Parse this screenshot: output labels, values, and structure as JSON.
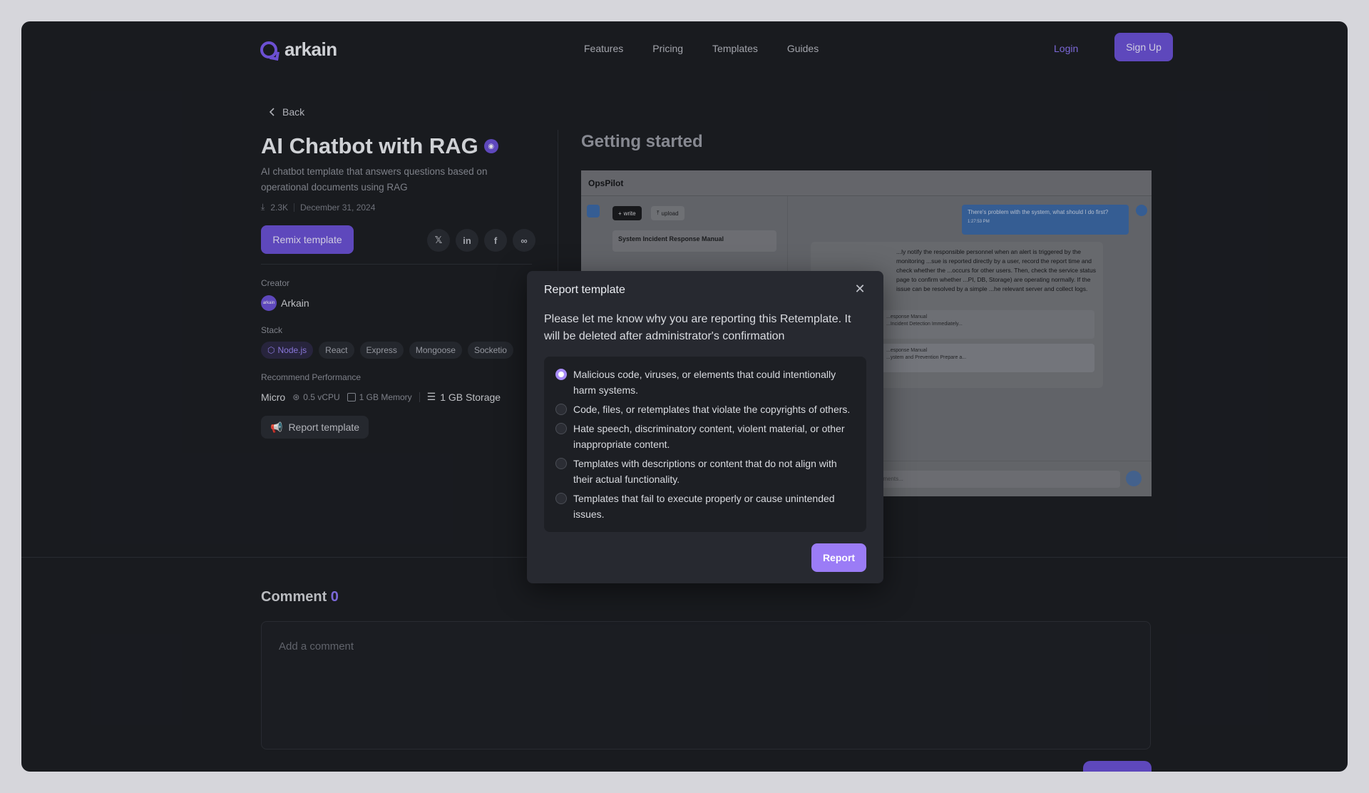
{
  "header": {
    "logo_text": "arkain",
    "nav": [
      "Features",
      "Pricing",
      "Templates",
      "Guides"
    ],
    "login": "Login",
    "signup": "Sign Up"
  },
  "template": {
    "back": "Back",
    "title": "AI Chatbot with RAG",
    "description": "AI chatbot template that answers questions based on operational documents using RAG",
    "downloads": "2.3K",
    "date": "December 31, 2024",
    "remix": "Remix template",
    "share_icons": [
      "x-icon",
      "linkedin-icon",
      "facebook-icon",
      "link-icon"
    ],
    "creator_label": "Creator",
    "creator_name": "Arkain",
    "creator_avatar_text": "arkain",
    "stack_label": "Stack",
    "stack": [
      "Node.js",
      "React",
      "Express",
      "Mongoose",
      "Socketio"
    ],
    "perf_label": "Recommend Performance",
    "perf": {
      "tier": "Micro",
      "cpu": "0.5 vCPU",
      "memory": "1 GB Memory",
      "storage": "1 GB Storage"
    },
    "report": "Report template"
  },
  "preview": {
    "section_title": "Getting started",
    "app_name": "OpsPilot",
    "write": "write",
    "upload": "upload",
    "doc_item": "System Incident Response Manual",
    "user_message": "There's problem with the system, what should I do first?",
    "message_time": "1:27:53 PM",
    "answer": "...ly notify the responsible personnel when an alert is triggered by the monitoring ...sue is reported directly by a user, record the report time and check whether the ...occurs for other users. Then, check the service status page to confirm whether ...PI, DB, Storage) are operating normally. If the issue can be resolved by a simple ...he relevant server and collect logs.",
    "source_1": "...esponse Manual",
    "source_1_sub": "...Incident Detection Immediately...",
    "source_2": "...esponse Manual",
    "source_2_sub": "...ystem and Prevention Prepare a...",
    "input_placeholder": "...ur documents..."
  },
  "comments": {
    "title": "Comment",
    "count": "0",
    "placeholder": "Add a comment"
  },
  "modal": {
    "title": "Report template",
    "intro": "Please let me know why you are reporting this Retemplate. It will be deleted after administrator's confirmation",
    "reasons": [
      {
        "text": "Malicious code, viruses, or elements that could intentionally harm systems.",
        "selected": true
      },
      {
        "text": "Code, files, or retemplates that violate the copyrights of others.",
        "selected": false
      },
      {
        "text": "Hate speech, discriminatory content, violent material, or other inappropriate content.",
        "selected": false
      },
      {
        "text": "Templates with descriptions or content that do not align with their actual functionality.",
        "selected": false
      },
      {
        "text": "Templates that fail to execute properly or cause unintended issues.",
        "selected": false
      }
    ],
    "submit": "Report"
  },
  "colors": {
    "accent": "#6b52d6",
    "accent_light": "#9b7cf6",
    "background": "#1d1f24",
    "modal": "#272930"
  }
}
